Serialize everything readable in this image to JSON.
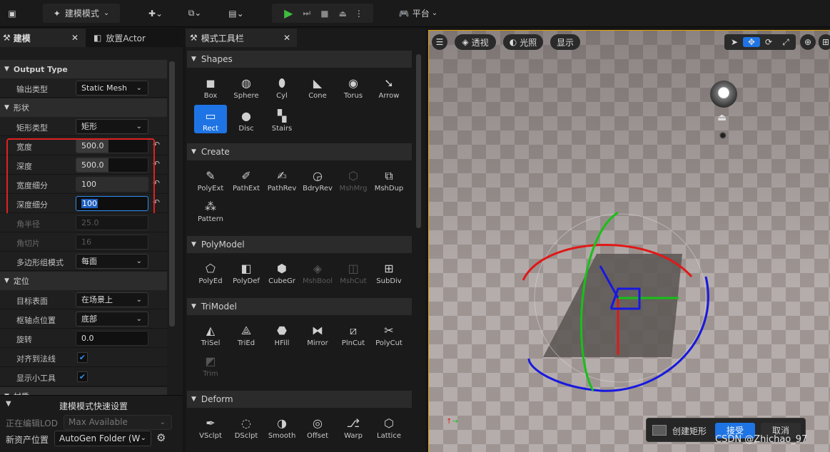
{
  "toolbar": {
    "mode_label": "建模模式",
    "platform_label": "平台"
  },
  "left_tabs": [
    {
      "label": "建模"
    },
    {
      "label": "放置Actor"
    }
  ],
  "sections": {
    "output_type": "Output Type",
    "shape": "形状",
    "position": "定位",
    "cutoff": "材质"
  },
  "rows": {
    "output_type": {
      "label": "输出类型",
      "value": "Static Mesh"
    },
    "rect_type": {
      "label": "矩形类型",
      "value": "矩形"
    },
    "width": {
      "label": "宽度",
      "value": "500.0"
    },
    "depth": {
      "label": "深度",
      "value": "500.0"
    },
    "width_sub": {
      "label": "宽度细分",
      "value": "100"
    },
    "depth_sub": {
      "label": "深度细分",
      "value": "100"
    },
    "corner_radius": {
      "label": "角半径",
      "value": "25.0"
    },
    "corner_slices": {
      "label": "角切片",
      "value": "16"
    },
    "polygroup_mode": {
      "label": "多边形组模式",
      "value": "每面"
    },
    "target_surface": {
      "label": "目标表面",
      "value": "在场景上"
    },
    "pivot": {
      "label": "枢轴点位置",
      "value": "底部"
    },
    "rotation": {
      "label": "旋转",
      "value": "0.0"
    },
    "align_normal": {
      "label": "对齐到法线"
    },
    "show_gizmo": {
      "label": "显示小工具"
    }
  },
  "bottom": {
    "title": "建模模式快速设置",
    "lod_label": "正在编辑LOD",
    "lod_value": "Max Available",
    "asset_label": "新资产位置",
    "asset_value": "AutoGen Folder (W"
  },
  "mid": {
    "title": "模式工具栏",
    "sections": [
      {
        "name": "Shapes",
        "tools": [
          "Box",
          "Sphere",
          "Cyl",
          "Cone",
          "Torus",
          "Arrow",
          "Rect",
          "Disc",
          "Stairs"
        ]
      },
      {
        "name": "Create",
        "tools": [
          "PolyExt",
          "PathExt",
          "PathRev",
          "BdryRev",
          "MshMrg",
          "MshDup",
          "Pattern"
        ]
      },
      {
        "name": "PolyModel",
        "tools": [
          "PolyEd",
          "PolyDef",
          "CubeGr",
          "MshBool",
          "MshCut",
          "SubDiv"
        ]
      },
      {
        "name": "TriModel",
        "tools": [
          "TriSel",
          "TriEd",
          "HFill",
          "Mirror",
          "PlnCut",
          "PolyCut",
          "Trim"
        ]
      },
      {
        "name": "Deform",
        "tools": [
          "VSclpt",
          "DSclpt",
          "Smooth",
          "Offset",
          "Warp",
          "Lattice"
        ]
      }
    ]
  },
  "viewport": {
    "perspective": "透视",
    "lighting": "光照",
    "show": "显示"
  },
  "popup": {
    "label": "创建矩形",
    "accept": "接受",
    "cancel": "取消"
  },
  "watermark": "CSDN @Zhichao_97",
  "colors": {
    "accent": "#1e74e4",
    "highlight": "#e02020",
    "gizmo_x": "#e01818",
    "gizmo_y": "#18c018",
    "gizmo_z": "#1818e0"
  }
}
